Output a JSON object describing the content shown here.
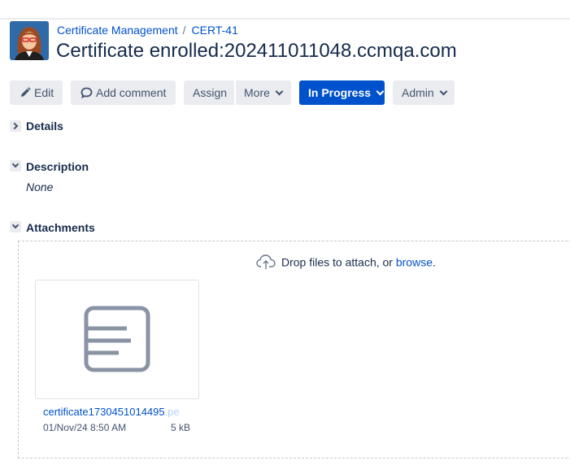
{
  "header": {
    "breadcrumb": {
      "project": "Certificate Management",
      "separator": "/",
      "issue_key": "CERT-41"
    },
    "title": "Certificate enrolled:202411011048.ccmqa.com",
    "avatar_icon": "user-avatar-icon"
  },
  "toolbar": {
    "edit_label": "Edit",
    "edit_icon": "pencil-icon",
    "comment_label": "Add comment",
    "comment_icon": "speech-bubble-icon",
    "assign_label": "Assign",
    "more_label": "More",
    "status_label": "In Progress",
    "admin_label": "Admin",
    "status_color": "#0052cc"
  },
  "sections": {
    "details": {
      "title": "Details",
      "expanded": false
    },
    "description": {
      "title": "Description",
      "expanded": true,
      "value": "None"
    },
    "attachments": {
      "title": "Attachments",
      "expanded": true
    }
  },
  "attachments": {
    "drop_text": "Drop files to attach, or ",
    "browse_label": "browse",
    "browse_suffix": ".",
    "upload_icon": "cloud-upload-icon",
    "files": [
      {
        "name_visible": "certificate1730451014495",
        "name_faded": ".pe",
        "date": "01/Nov/24 8:50 AM",
        "size": "5 kB",
        "icon": "document-icon"
      }
    ]
  },
  "colors": {
    "link": "#0052cc",
    "text": "#172b4d",
    "button_bg": "#ebecf0"
  }
}
